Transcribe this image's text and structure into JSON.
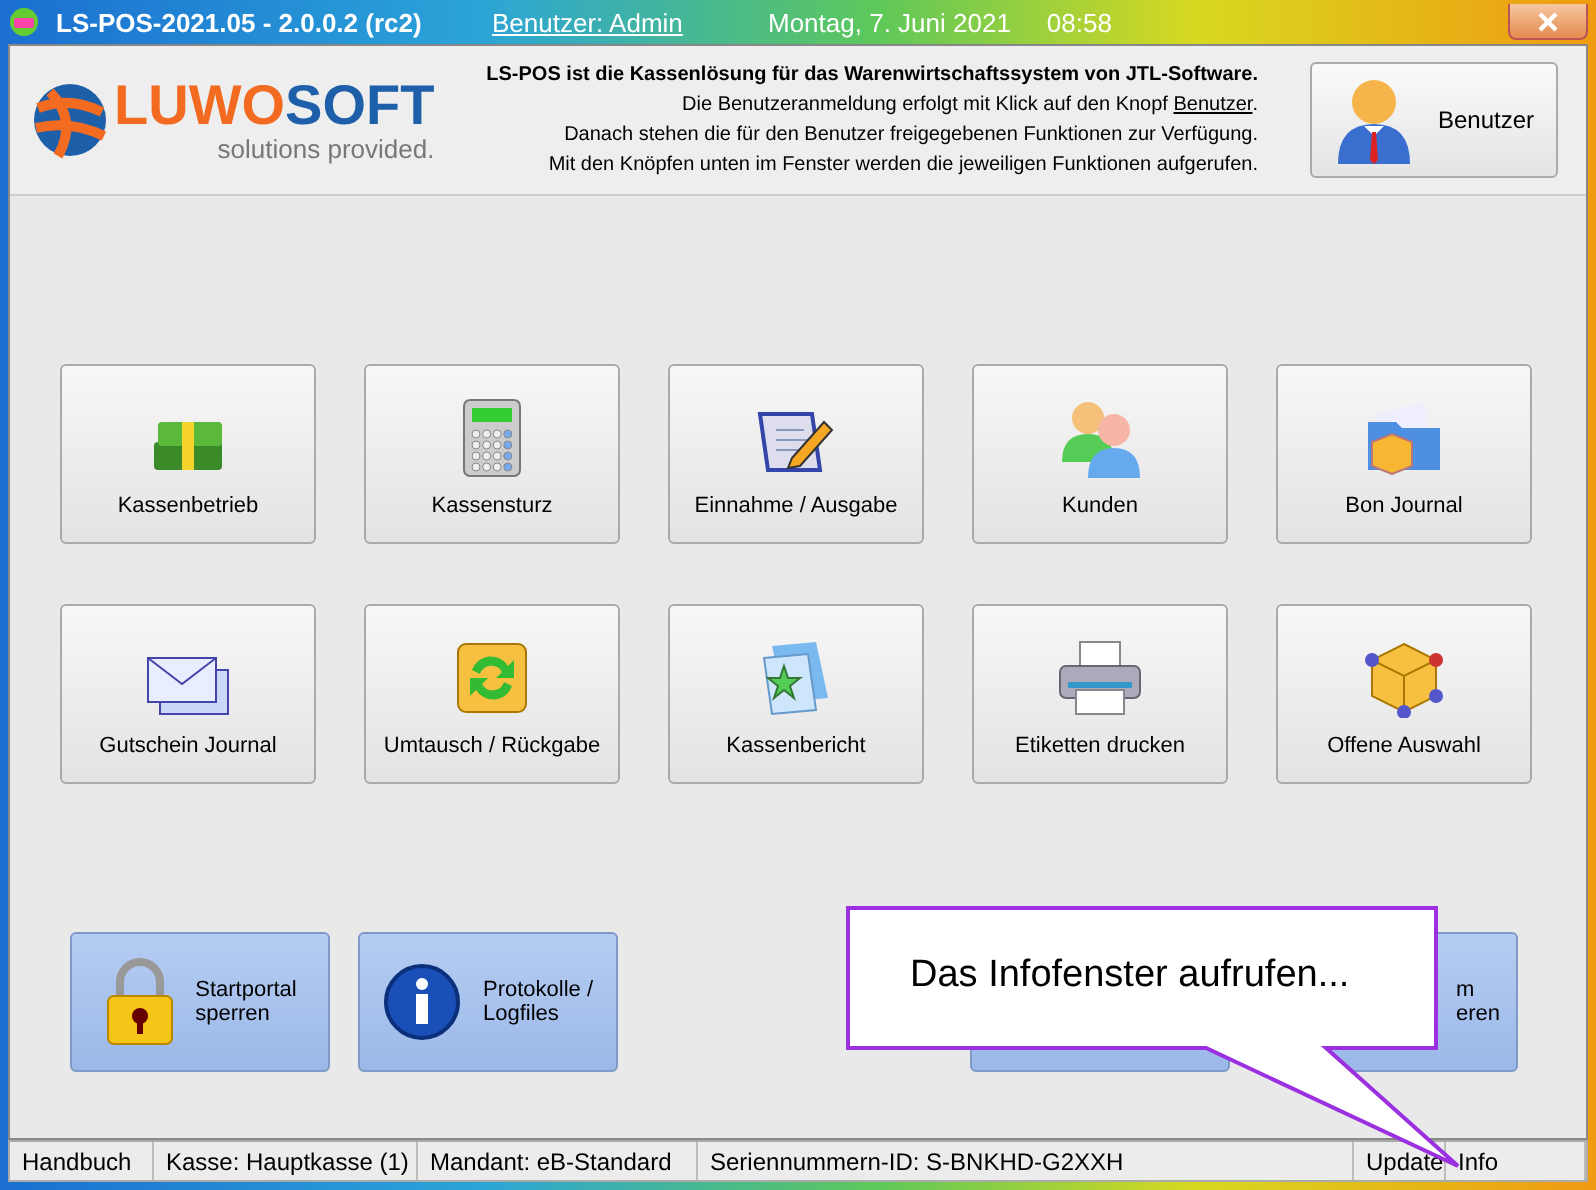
{
  "window": {
    "title": "LS-POS-2021.05 - 2.0.0.2 (rc2)",
    "user_link": "Benutzer: Admin",
    "date": "Montag, 7. Juni 2021",
    "time": "08:58"
  },
  "header": {
    "logo_word_a": "LUWO",
    "logo_word_b": "SOFT",
    "logo_tagline": "solutions provided.",
    "intro_title": "LS-POS ist die Kassenlösung für das Warenwirtschaftssystem von JTL-Software.",
    "intro_lines": [
      "Die Benutzeranmeldung erfolgt mit Klick auf den Knopf **Benutzer**.",
      "Danach stehen die für den Benutzer freigegebenen Funktionen zur Verfügung.",
      "Mit den Knöpfen unten im Fenster werden die jeweiligen Funktionen aufgerufen."
    ],
    "user_button": "Benutzer"
  },
  "function_buttons": [
    {
      "label": "Kassenbetrieb",
      "kind": "money"
    },
    {
      "label": "Kassensturz",
      "kind": "calculator"
    },
    {
      "label": "Einnahme / Ausgabe",
      "kind": "notepad"
    },
    {
      "label": "Kunden",
      "kind": "people"
    },
    {
      "label": "Bon Journal",
      "kind": "folder"
    },
    {
      "label": "Gutschein Journal",
      "kind": "envelope"
    },
    {
      "label": "Umtausch / Rückgabe",
      "kind": "exchange"
    },
    {
      "label": "Kassenbericht",
      "kind": "star"
    },
    {
      "label": "Etiketten drucken",
      "kind": "printer"
    },
    {
      "label": "Offene Auswahl",
      "kind": "cube"
    }
  ],
  "bottom_buttons": [
    {
      "lines": [
        "Startportal",
        "sperren"
      ],
      "kind": "lock"
    },
    {
      "lines": [
        "Protokolle /",
        "Logfiles"
      ],
      "kind": "info"
    },
    {
      "kind": "hidden"
    },
    {
      "lines": [
        "m",
        "eren"
      ],
      "kind": "hidden"
    }
  ],
  "tooltip": "Das Infofenster aufrufen...",
  "status_bar": [
    "Handbuch",
    "Kasse: Hauptkasse (1)",
    "Mandant: eB-Standard",
    "Seriennummern-ID:  S-BNKHD-G2XXH",
    "Update",
    "Info"
  ]
}
